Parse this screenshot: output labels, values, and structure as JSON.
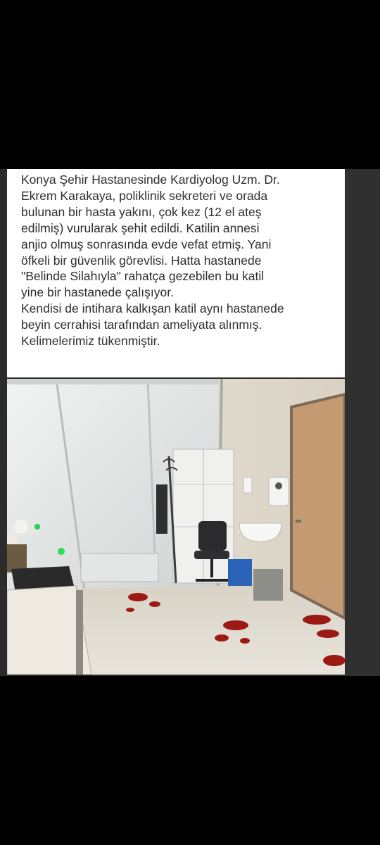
{
  "post": {
    "text": "Konya Şehir Hastanesinde Kardiyolog Uzm. Dr.\nEkrem Karakaya, poliklinik sekreteri ve orada\nbulunan bir hasta yakını, çok kez (12 el ateş\nedilmiş) vurularak şehit edildi. Katilin annesi\nanjio olmuş sonrasında evde vefat etmiş. Yani\nöfkeli bir güvenlik görevlisi. Hatta hastanede\n\"Belinde Silahıyla\" rahatça gezebilen bu katil\nyine bir hastanede çalışıyor.\nKendisi de intihara kalkışan katil aynı hastanede\nbeyin cerrahisi tarafından ameliyata alınmış.\nKelimelerimiz tükenmiştir."
  },
  "colors": {
    "background": "#000000",
    "card": "#2c2c2c",
    "text_panel": "#ffffff",
    "text": "#2e2e2e",
    "wall": "#e6e1d6",
    "floor": "#ddd7cc",
    "door": "#c49a72",
    "blood": "#9c1a14"
  }
}
